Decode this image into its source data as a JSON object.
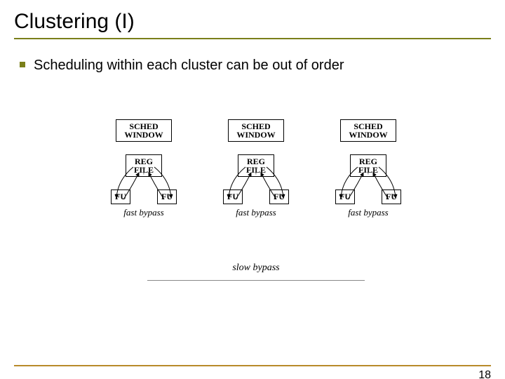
{
  "title": "Clustering (I)",
  "bullet": "Scheduling within each cluster can be out of order",
  "diagram": {
    "sched_line1": "SCHED",
    "sched_line2": "WINDOW",
    "reg_line1": "REG",
    "reg_line2": "FILE",
    "fu": "FU",
    "fast": "fast bypass",
    "slow": "slow bypass",
    "up_arrow": "↑"
  },
  "page": "18"
}
